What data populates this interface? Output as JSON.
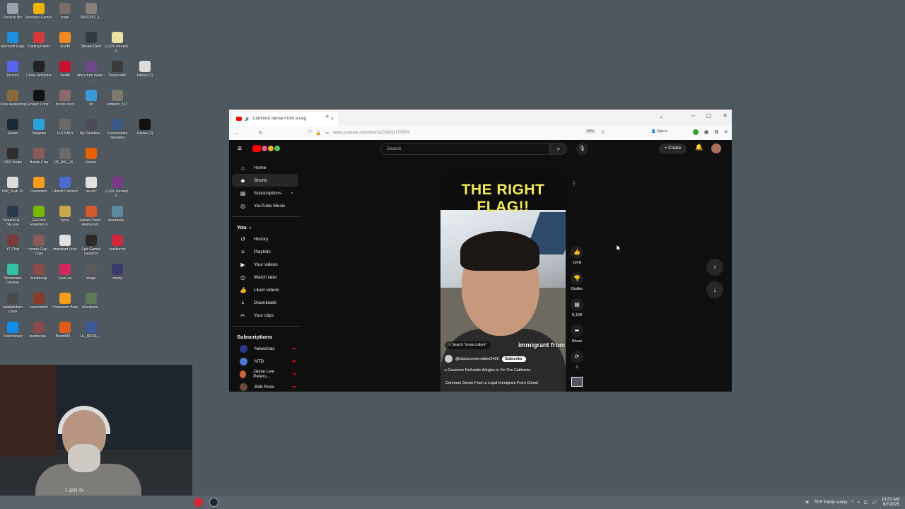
{
  "desktop": {
    "icons": [
      {
        "label": "Recycle Bin",
        "color": "#9aa3b0"
      },
      {
        "label": "Rockstar Games ...",
        "color": "#f0b400"
      },
      {
        "label": "mojo",
        "color": "#7a6c66"
      },
      {
        "label": "28162261_1...",
        "color": "#8a7e78"
      },
      {
        "label": "Microsoft Edge",
        "color": "#1d8fe1"
      },
      {
        "label": "Trading Paints",
        "color": "#d33a3a"
      },
      {
        "label": "FiveM",
        "color": "#f08a24"
      },
      {
        "label": "Stream Deck",
        "color": "#333a44"
      },
      {
        "label": "(3,626 unread) - b...",
        "color": "#e8e4a0"
      },
      {
        "label": "Discord",
        "color": "#5865f2"
      },
      {
        "label": "Crime Simulator",
        "color": "#222222"
      },
      {
        "label": "RedM",
        "color": "#c8102e"
      },
      {
        "label": "dmca free music - ...",
        "color": "#6e4a8a"
      },
      {
        "label": "TruckersMP",
        "color": "#3a3a3a"
      },
      {
        "label": "fullsize (2)",
        "color": "#dddddd"
      },
      {
        "label": "Dune Awakening",
        "color": "#8a6a3a"
      },
      {
        "label": "Fanatec Contr...",
        "color": "#111111"
      },
      {
        "label": "hundo clock",
        "color": "#8a6a6a"
      },
      {
        "label": "uh",
        "color": "#3a9ad9"
      },
      {
        "label": "emblem_512",
        "color": "#7a7a6a"
      },
      {
        "label": "Steam",
        "color": "#1b2838"
      },
      {
        "label": "Telegram",
        "color": "#2aa3dd"
      },
      {
        "label": "FUCKBOI",
        "color": "#6a6a6a"
      },
      {
        "label": "My Dashboa...",
        "color": "#4a4a5a"
      },
      {
        "label": "Supermarket Simulator",
        "color": "#3a5a8a"
      },
      {
        "label": "fullsize (3)",
        "color": "#111111"
      },
      {
        "label": "OBS Studio",
        "color": "#302e31"
      },
      {
        "label": "Hundo-Clap",
        "color": "#8a5a5a"
      },
      {
        "label": "FB_IMG_16...",
        "color": "#6a6a6a"
      },
      {
        "label": "Firefox",
        "color": "#e66000"
      },
      {
        "label": "Hell_Yeah-10",
        "color": "#dddddd"
      },
      {
        "label": "Overwatch",
        "color": "#f99e1a"
      },
      {
        "label": "Ubisoft Connect",
        "color": "#4a6ad0"
      },
      {
        "label": "ow acc",
        "color": "#e0e0e0"
      },
      {
        "label": "(3,626 unread) - b...",
        "color": "#7a3a8a"
      },
      {
        "label": "StreamEle... SE.Live",
        "color": "#2a3a4a"
      },
      {
        "label": "GeForce Experience",
        "color": "#76b900"
      },
      {
        "label": "tycar",
        "color": "#c8a84a"
      },
      {
        "label": "Kebab Chefs! - Restauran...",
        "color": "#d45a2a"
      },
      {
        "label": "silverback...",
        "color": "#5a8aa0"
      },
      {
        "label": "YT Chat",
        "color": "#7a3a3a"
      },
      {
        "label": "Hundo-Clap - Copy",
        "color": "#8a5a5a"
      },
      {
        "label": "Important Links",
        "color": "#e0e0e0"
      },
      {
        "label": "Epic Games Launcher",
        "color": "#2a2a2a"
      },
      {
        "label": "koolhundo",
        "color": "#d0283a"
      },
      {
        "label": "Streamlabs Desktop",
        "color": "#31c3a2"
      },
      {
        "label": "hundoclap",
        "color": "#8a4a4a"
      },
      {
        "label": "GeeGee",
        "color": "#d0285a"
      },
      {
        "label": "image",
        "color": "#5a5a5a"
      },
      {
        "label": "omety",
        "color": "#3a3a6a"
      },
      {
        "label": "ballandchain cyndi",
        "color": "#4a4a4a"
      },
      {
        "label": "hundostier3",
        "color": "#8a3a2a"
      },
      {
        "label": "Overwatch Beta",
        "color": "#f99e1a"
      },
      {
        "label": "silverback...",
        "color": "#5a7a5a"
      },
      {
        "label": "TeamViewer",
        "color": "#0e8ee9"
      },
      {
        "label": "hundoclap...",
        "color": "#8a4a4a"
      },
      {
        "label": "BeamMP-...",
        "color": "#e05a1a"
      },
      {
        "label": "LIL_MORE_...",
        "color": "#3a5a9a"
      }
    ]
  },
  "webcam": {
    "shirt_text": "I am tv"
  },
  "taskbar": {
    "weather": "75°F  Partly sunny",
    "time": "10:31 AM",
    "date": "6/7/2025"
  },
  "browser": {
    "tab_title": "Common Sense From a Leg",
    "url": "www.youtube.com/shorts/ZSMQLtT00F4",
    "zoom": "90%",
    "signin": "Sign in"
  },
  "youtube": {
    "search_placeholder": "Search",
    "create_label": "Create",
    "sidebar": {
      "items": [
        {
          "label": "Home",
          "icon": "home-icon",
          "glyph": "⌂"
        },
        {
          "label": "Shorts",
          "icon": "shorts-icon",
          "glyph": "◆"
        },
        {
          "label": "Subscriptions",
          "icon": "subscriptions-icon",
          "glyph": "▤"
        },
        {
          "label": "YouTube Music",
          "icon": "music-icon",
          "glyph": "◎"
        }
      ],
      "you_heading": "You",
      "you_items": [
        {
          "label": "History",
          "glyph": "↺"
        },
        {
          "label": "Playlists",
          "glyph": "≡"
        },
        {
          "label": "Your videos",
          "glyph": "▶"
        },
        {
          "label": "Watch later",
          "glyph": "◷"
        },
        {
          "label": "Liked videos",
          "glyph": "👍"
        },
        {
          "label": "Downloads",
          "glyph": "⤓"
        },
        {
          "label": "Your clips",
          "glyph": "✂"
        }
      ],
      "subscriptions_heading": "Subscriptions",
      "subscriptions": [
        {
          "label": "Newsmax",
          "color": "#2a3a8a"
        },
        {
          "label": "NTD",
          "color": "#4a7ad0"
        },
        {
          "label": "Jesse Lee Peters...",
          "color": "#c86a3a"
        },
        {
          "label": "Bob Ross",
          "color": "#6a4a3a"
        }
      ]
    },
    "short": {
      "headline_line1": "THE RIGHT",
      "headline_line2": "FLAG!!",
      "caption": "immigrant from",
      "search_pill": "Search \"texas culture\"",
      "channel": "@blackconservative2429",
      "subscribe": "Subscribe",
      "related": "Governor DeSantis Weighs in On The California",
      "title": "Common Sense From a Legal Immigrant From China!"
    },
    "actions": {
      "likes": "107K",
      "dislike": "Dislike",
      "comments": "8,198",
      "share": "Share",
      "remix": "1"
    }
  }
}
